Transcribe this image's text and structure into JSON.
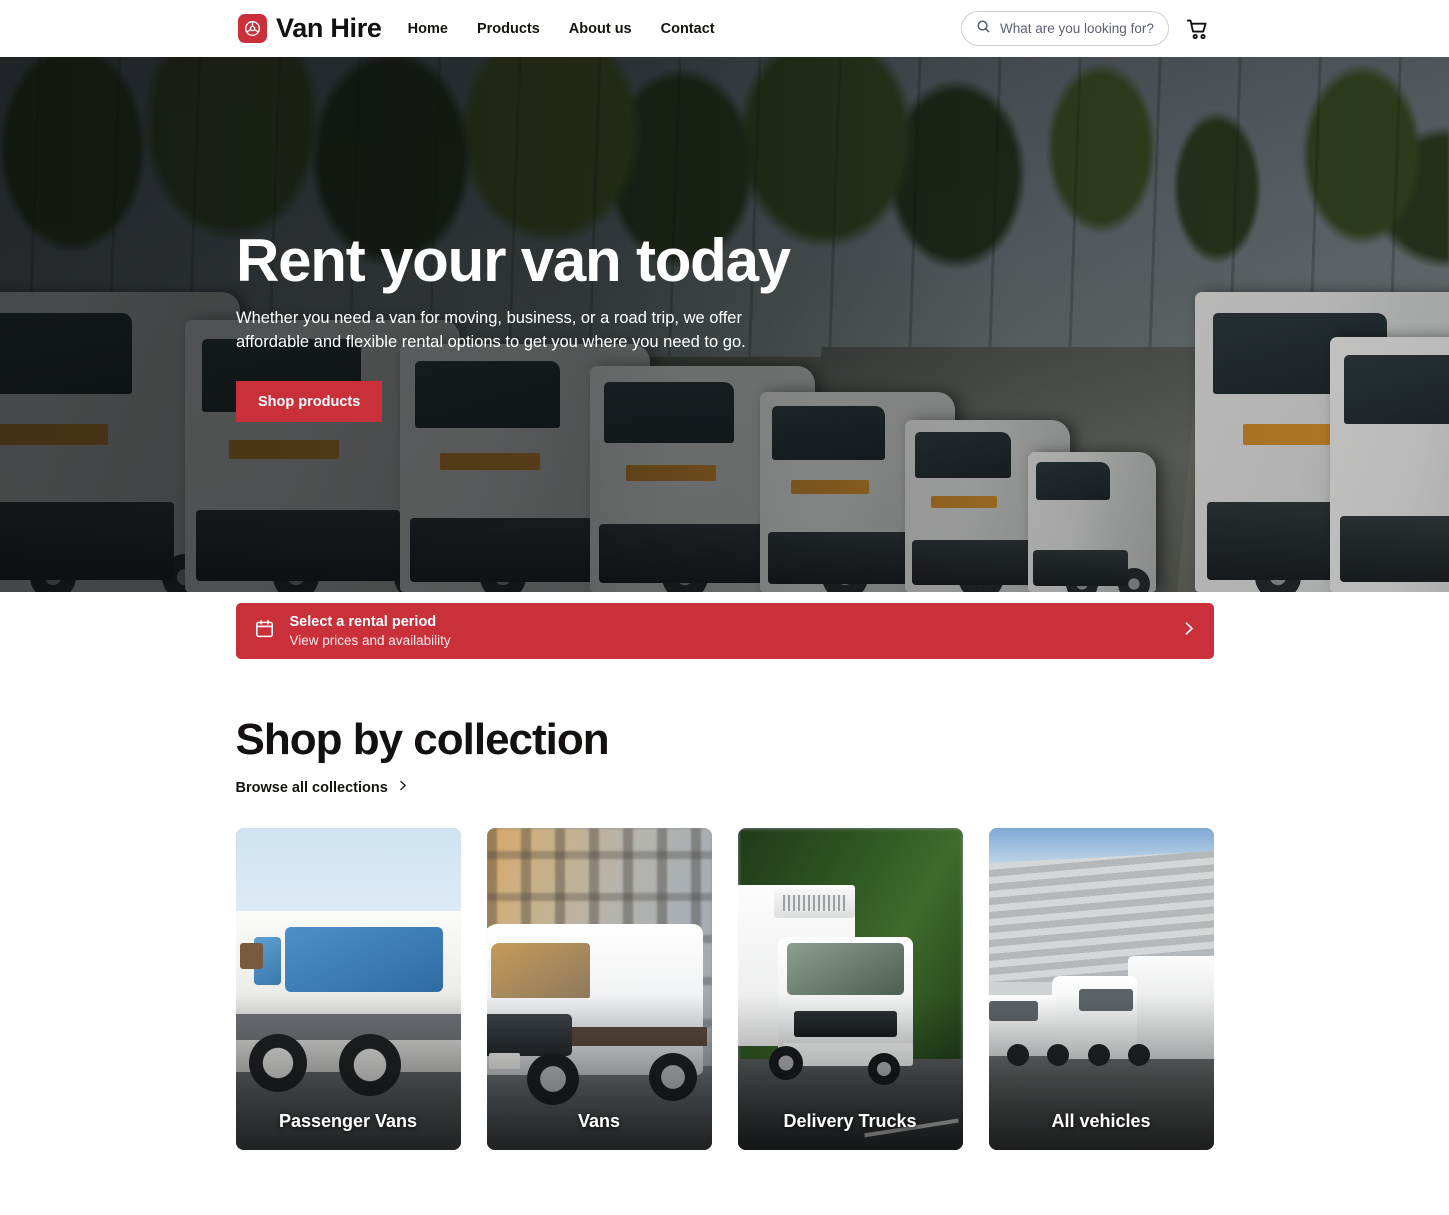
{
  "header": {
    "brand_name": "Van Hire",
    "brand_icon": "steering-wheel-icon",
    "nav": [
      {
        "label": "Home"
      },
      {
        "label": "Products"
      },
      {
        "label": "About us"
      },
      {
        "label": "Contact"
      }
    ],
    "search": {
      "placeholder": "What are you looking for?",
      "value": "",
      "icon": "search-icon"
    },
    "cart_icon": "shopping-cart-icon"
  },
  "hero": {
    "title": "Rent your van today",
    "subtitle": "Whether you need a van for moving, business, or a road trip, we offer affordable and flexible rental options to get you where you need to go.",
    "cta_label": "Shop products",
    "image_alt": "Fleet of white rental vans parked in rows"
  },
  "rental_banner": {
    "icon": "calendar-icon",
    "title": "Select a rental period",
    "subtitle": "View prices and availability",
    "chevron_icon": "chevron-right-icon"
  },
  "collections": {
    "title": "Shop by collection",
    "browse_all_label": "Browse all collections",
    "browse_all_icon": "chevron-right-icon",
    "cards": [
      {
        "label": "Passenger Vans",
        "image_alt": "White passenger van on a road"
      },
      {
        "label": "Vans",
        "image_alt": "White cargo van driving on a city street"
      },
      {
        "label": "Delivery Trucks",
        "image_alt": "White box delivery truck on a forest road"
      },
      {
        "label": "All vehicles",
        "image_alt": "Three white vans parked by an industrial building"
      }
    ]
  },
  "colors": {
    "brand_red": "#c9303a",
    "text_dark": "#141010",
    "page_background": "#ffffff",
    "search_border": "#c9cdd6",
    "placeholder_text": "#5a6274"
  }
}
